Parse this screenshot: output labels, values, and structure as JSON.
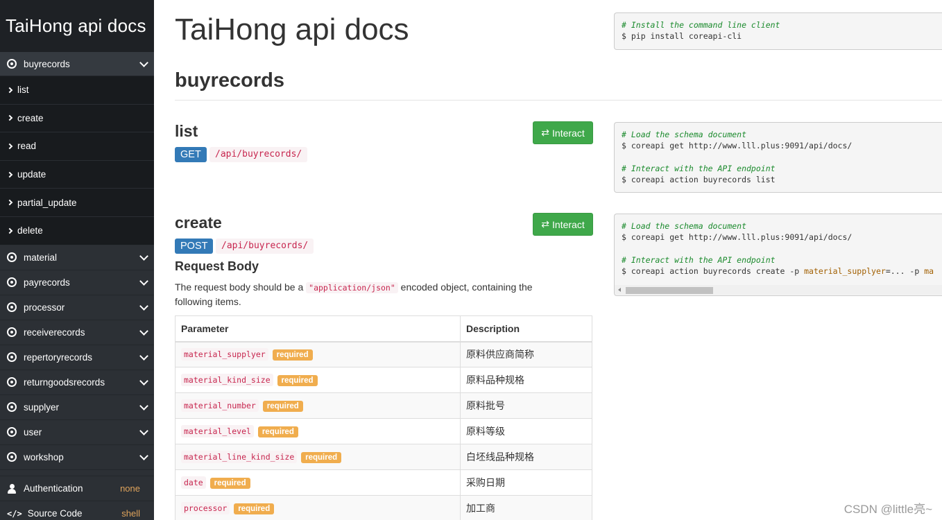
{
  "sidebar": {
    "brand": "TaiHong api docs",
    "active_group": "buyrecords",
    "sub_items": [
      "list",
      "create",
      "read",
      "update",
      "partial_update",
      "delete"
    ],
    "groups": [
      "material",
      "payrecords",
      "processor",
      "receiverecords",
      "repertoryrecords",
      "returngoodsrecords",
      "supplyer",
      "user",
      "workshop"
    ],
    "auth_label": "Authentication",
    "auth_value": "none",
    "source_label": "Source Code",
    "source_value": "shell"
  },
  "main": {
    "title": "TaiHong api docs",
    "section": "buyrecords",
    "interact_label": "Interact",
    "list": {
      "title": "list",
      "method": "GET",
      "path": "/api/buyrecords/"
    },
    "create": {
      "title": "create",
      "method": "POST",
      "path": "/api/buyrecords/",
      "request_body_title": "Request Body",
      "desc_before": "The request body should be a ",
      "desc_code": "\"application/json\"",
      "desc_after": " encoded object, containing the following items."
    },
    "table": {
      "headers": [
        "Parameter",
        "Description"
      ],
      "required_label": "required",
      "rows": [
        {
          "name": "material_supplyer",
          "desc": "原料供应商简称"
        },
        {
          "name": "material_kind_size",
          "desc": "原料品种规格"
        },
        {
          "name": "material_number",
          "desc": "原料批号"
        },
        {
          "name": "material_level",
          "desc": "原料等级"
        },
        {
          "name": "material_line_kind_size",
          "desc": "白坯线品种规格"
        },
        {
          "name": "date",
          "desc": "采购日期"
        },
        {
          "name": "processor",
          "desc": "加工商"
        }
      ]
    }
  },
  "code": {
    "install_comment": "# Install the command line client",
    "install_cmd": "$ pip install coreapi-cli",
    "load_comment": "# Load the schema document",
    "load_cmd": "$ coreapi get http://www.lll.plus:9091/api/docs/",
    "interact_comment": "# Interact with the API endpoint",
    "list_cmd": "$ coreapi action buyrecords list",
    "create_cmd_prefix": "$ coreapi action buyrecords create -p ",
    "create_cmd_param": "material_supplyer",
    "create_cmd_rest": "=... -p ",
    "create_cmd_tail": "ma"
  },
  "watermark": "CSDN @little亮~",
  "colors": {
    "sidebar_bg": "#2c3035",
    "interact_green": "#3fa84a",
    "get_blue": "#337ab7",
    "required_orange": "#f0ad4e",
    "code_red": "#c7254e"
  }
}
